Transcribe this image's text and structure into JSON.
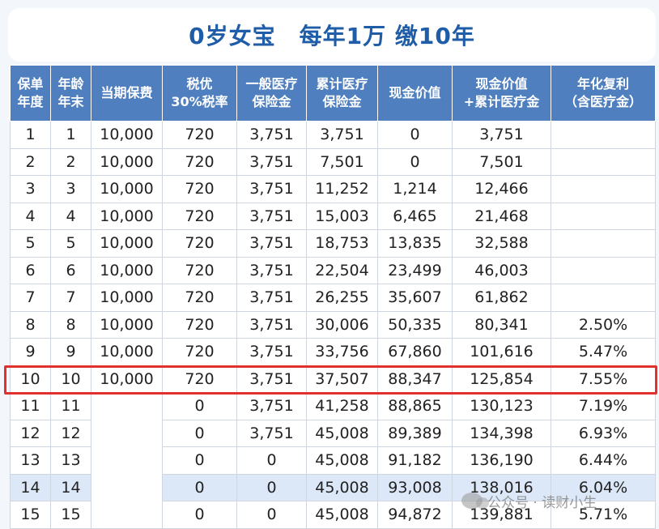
{
  "title": "0岁女宝　每年1万 缴10年",
  "table": {
    "headers": [
      [
        "保单",
        "年度"
      ],
      [
        "年龄",
        "年末"
      ],
      [
        "当期保费"
      ],
      [
        "税优",
        "30%税率"
      ],
      [
        "一般医疗",
        "保险金"
      ],
      [
        "累计医疗",
        "保险金"
      ],
      [
        "现金价值"
      ],
      [
        "现金价值",
        "+累计医疗金"
      ],
      [
        "年化复利",
        "（含医疗金）"
      ]
    ],
    "rows": [
      [
        "1",
        "1",
        "10,000",
        "720",
        "3,751",
        "3,751",
        "0",
        "3,751",
        ""
      ],
      [
        "2",
        "2",
        "10,000",
        "720",
        "3,751",
        "7,501",
        "0",
        "7,501",
        ""
      ],
      [
        "3",
        "3",
        "10,000",
        "720",
        "3,751",
        "11,252",
        "1,214",
        "12,466",
        ""
      ],
      [
        "4",
        "4",
        "10,000",
        "720",
        "3,751",
        "15,003",
        "6,465",
        "21,468",
        ""
      ],
      [
        "5",
        "5",
        "10,000",
        "720",
        "3,751",
        "18,753",
        "13,835",
        "32,588",
        ""
      ],
      [
        "6",
        "6",
        "10,000",
        "720",
        "3,751",
        "22,504",
        "23,499",
        "46,003",
        ""
      ],
      [
        "7",
        "7",
        "10,000",
        "720",
        "3,751",
        "26,255",
        "35,607",
        "61,862",
        ""
      ],
      [
        "8",
        "8",
        "10,000",
        "720",
        "3,751",
        "30,006",
        "50,335",
        "80,341",
        "2.50%"
      ],
      [
        "9",
        "9",
        "10,000",
        "720",
        "3,751",
        "33,756",
        "67,860",
        "101,616",
        "5.47%"
      ],
      [
        "10",
        "10",
        "10,000",
        "720",
        "3,751",
        "37,507",
        "88,347",
        "125,854",
        "7.55%"
      ],
      [
        "11",
        "11",
        "",
        "0",
        "3,751",
        "41,258",
        "88,865",
        "130,123",
        "7.19%"
      ],
      [
        "12",
        "12",
        "",
        "0",
        "3,751",
        "45,008",
        "89,389",
        "134,398",
        "6.93%"
      ],
      [
        "13",
        "13",
        "",
        "0",
        "0",
        "45,008",
        "91,182",
        "136,190",
        "6.44%"
      ],
      [
        "14",
        "14",
        "",
        "0",
        "0",
        "45,008",
        "93,008",
        "138,016",
        "6.04%"
      ],
      [
        "15",
        "15",
        "",
        "0",
        "0",
        "45,008",
        "94,872",
        "139,881",
        "5.71%"
      ]
    ]
  },
  "watermark": {
    "text": "公众号 · 读财小生",
    "icon": "wechat-icon"
  },
  "colors": {
    "title": "#1f5da8",
    "header_bg": "#4f7fbf",
    "highlight_border": "#e0312f",
    "row_highlight": "#dce8f7"
  }
}
